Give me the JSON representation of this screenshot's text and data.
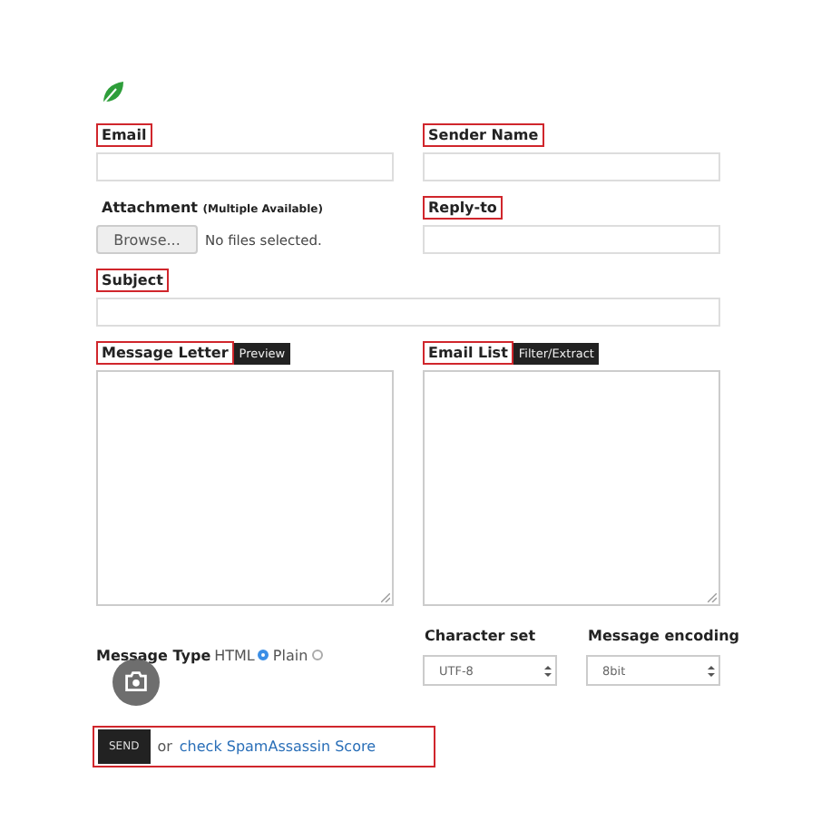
{
  "email": {
    "label": "Email",
    "highlighted": true
  },
  "sender_name": {
    "label": "Sender Name",
    "highlighted": true
  },
  "attachment": {
    "label": "Attachment",
    "note": "(Multiple Available)",
    "button": "Browse...",
    "status": "No files selected."
  },
  "reply_to": {
    "label": "Reply-to",
    "highlighted": true
  },
  "subject": {
    "label": "Subject",
    "highlighted": true
  },
  "message_letter": {
    "label": "Message Letter",
    "highlighted": true,
    "tag": "Preview"
  },
  "email_list": {
    "label": "Email List",
    "highlighted": true,
    "tag": "Filter/Extract"
  },
  "message_type": {
    "label": "Message Type",
    "options": [
      {
        "label": "HTML",
        "selected": true
      },
      {
        "label": "Plain",
        "selected": false
      }
    ]
  },
  "character_set": {
    "label": "Character set",
    "value": "UTF-8"
  },
  "message_encoding": {
    "label": "Message encoding",
    "value": "8bit"
  },
  "send": {
    "button": "SEND",
    "joiner": "or",
    "link": "check SpamAssassin Score",
    "highlighted": true
  }
}
